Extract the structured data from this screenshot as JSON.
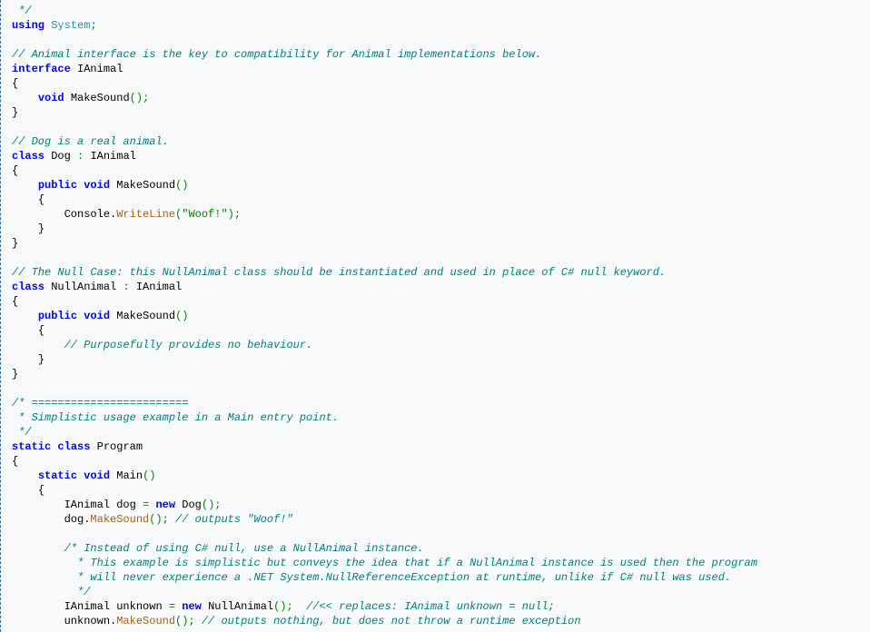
{
  "code": {
    "t_starComment": " */",
    "kw_using": "using",
    "ty_System": "System",
    "semi": ";",
    "cm_iface": "// Animal interface is the key to compatibility for Animal implementations below.",
    "kw_interface": "interface",
    "ty_IAnimal": "IAnimal",
    "brace_open": "{",
    "brace_close": "}",
    "kw_void": "void",
    "m_MakeSound": "MakeSound",
    "parens": "()",
    "cm_dog": "// Dog is a real animal.",
    "kw_class": "class",
    "ty_Dog": "Dog",
    "colon": " : ",
    "kw_public": "public",
    "ty_Console": "Console",
    "dot": ".",
    "m_WriteLine": "WriteLine",
    "paren_open": "(",
    "paren_close": ")",
    "str_woof": "\"Woof!\"",
    "cm_null": "// The Null Case: this NullAnimal class should be instantiated and used in place of C# null keyword.",
    "ty_NullAnimal": "NullAnimal",
    "cm_purposeful": "// Purposefully provides no behaviour.",
    "cm_sep1": "/* ========================",
    "cm_sep2": " * Simplistic usage example in a Main entry point.",
    "cm_sep3": " */",
    "kw_static": "static",
    "ty_Program": "Program",
    "m_Main": "Main",
    "id_dog": "dog",
    "op_eq": " = ",
    "kw_new": "new",
    "cm_out_woof": "// outputs \"Woof!\"",
    "cm_blk1": "/* Instead of using C# null, use a NullAnimal instance.",
    "cm_blk2": " * This example is simplistic but conveys the idea that if a NullAnimal instance is used then the program",
    "cm_blk3": " * will never experience a .NET System.NullReferenceException at runtime, unlike if C# null was used.",
    "cm_blk4": " */",
    "id_unknown": "unknown",
    "cm_replaces": "//<< replaces: IAnimal unknown = null;",
    "cm_outputs_nothing": "// outputs nothing, but does not throw a runtime exception"
  }
}
